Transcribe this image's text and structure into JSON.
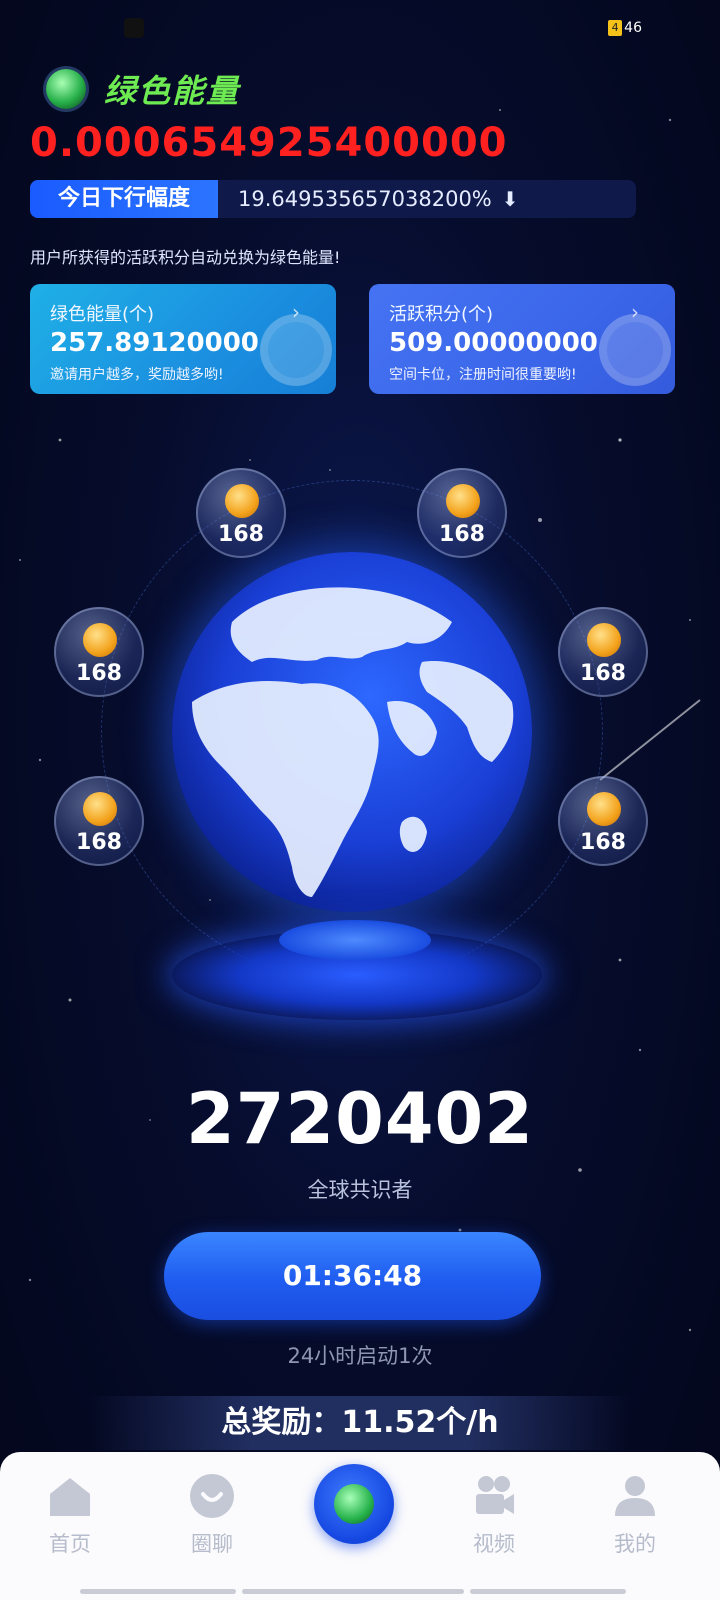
{
  "status_bar": {
    "battery": "46",
    "battery_badge": "4"
  },
  "header": {
    "app_title": "绿色能量"
  },
  "main_value": "0.000654925400000",
  "decline": {
    "label": "今日下行幅度",
    "value": "19.649535657038200%"
  },
  "info_text": "用户所获得的活跃积分自动兑换为绿色能量!",
  "cards": [
    {
      "title": "绿色能量(个)",
      "value": "257.89120000",
      "subtitle": "邀请用户越多，奖励越多哟!"
    },
    {
      "title": "活跃积分(个)",
      "value": "509.00000000",
      "subtitle": "空间卡位，注册时间很重要哟!"
    }
  ],
  "bubbles": [
    "168",
    "168",
    "168",
    "168",
    "168",
    "168"
  ],
  "participants": {
    "count": "2720402",
    "label": "全球共识者"
  },
  "timer": {
    "value": "01:36:48",
    "note": "24小时启动1次"
  },
  "reward": "总奖励：11.52个/h",
  "tabs": [
    {
      "label": "首页",
      "icon": "home-icon"
    },
    {
      "label": "圈聊",
      "icon": "chat-icon"
    },
    {
      "label": "",
      "icon": "mine-energy-icon"
    },
    {
      "label": "视频",
      "icon": "video-camera-icon"
    },
    {
      "label": "我的",
      "icon": "person-icon"
    }
  ],
  "colors": {
    "main_value": "#ff2020",
    "title_green": "#6eea52",
    "accent_blue": "#1f5cf0",
    "tab_inactive": "#b6bccb"
  }
}
